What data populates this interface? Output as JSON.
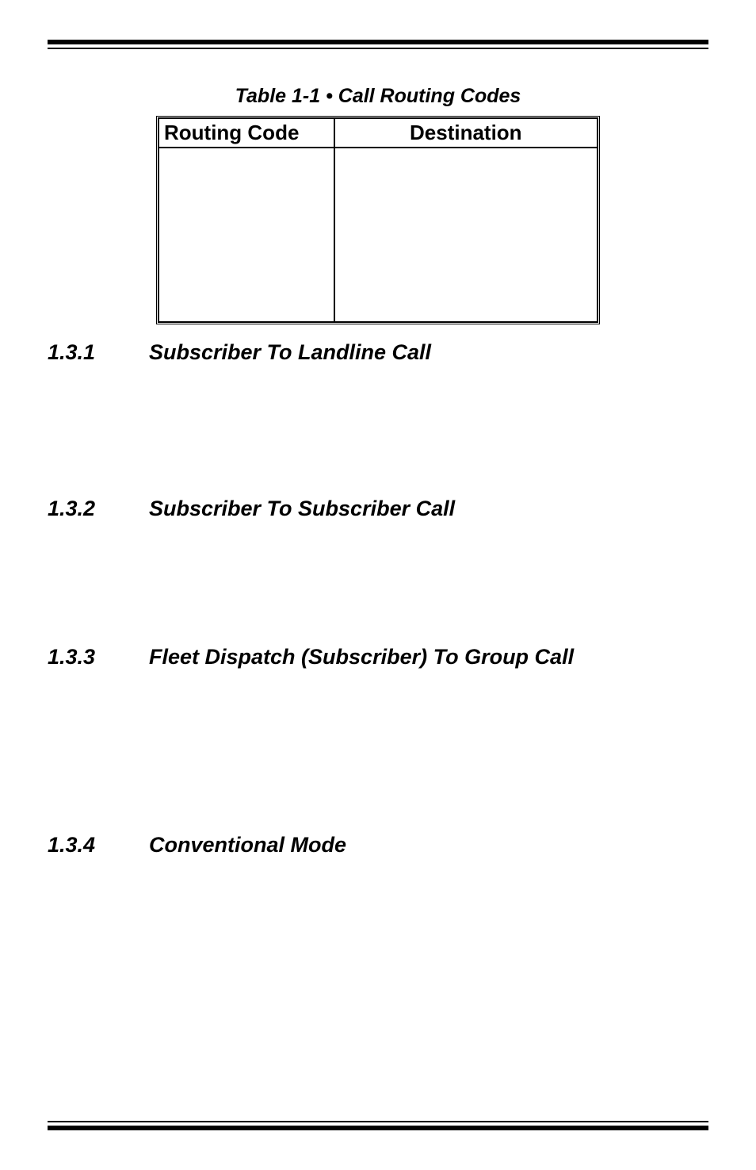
{
  "table": {
    "caption": "Table 1-1 • Call Routing Codes",
    "headers": {
      "code": "Routing Code",
      "dest": "Destination"
    }
  },
  "sections": {
    "s1": {
      "num": "1.3.1",
      "title": "Subscriber To Landline Call"
    },
    "s2": {
      "num": "1.3.2",
      "title": "Subscriber To Subscriber Call"
    },
    "s3": {
      "num": "1.3.3",
      "title": "Fleet Dispatch (Subscriber) To Group Call"
    },
    "s4": {
      "num": "1.3.4",
      "title": "Conventional Mode"
    }
  },
  "chart_data": {
    "type": "table",
    "title": "Table 1-1 • Call Routing Codes",
    "columns": [
      "Routing Code",
      "Destination"
    ],
    "rows": []
  }
}
